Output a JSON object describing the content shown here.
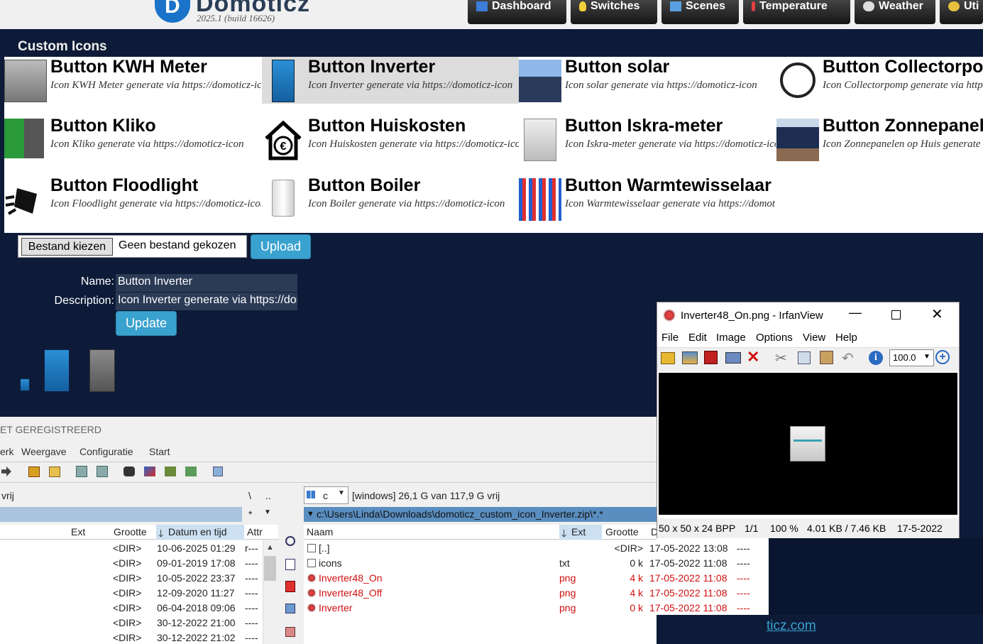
{
  "header": {
    "brand": "Domoticz",
    "version": "2025.1 (build 16626)",
    "nav": [
      {
        "label": "Dashboard",
        "icon": "dashboard-icon"
      },
      {
        "label": "Switches",
        "icon": "lightbulb-icon"
      },
      {
        "label": "Scenes",
        "icon": "scenes-icon"
      },
      {
        "label": "Temperature",
        "icon": "thermometer-icon"
      },
      {
        "label": "Weather",
        "icon": "cloud-icon"
      },
      {
        "label": "Uti",
        "icon": "utility-icon"
      }
    ]
  },
  "custom_icons": {
    "title": "Custom Icons",
    "items": [
      {
        "name": "Button KWH Meter",
        "desc": "Icon KWH Meter generate via https://domoticz-icon",
        "selected": false,
        "icon": "kwh-meter-icon"
      },
      {
        "name": "Button Inverter",
        "desc": "Icon Inverter generate via https://domoticz-icon",
        "selected": true,
        "icon": "inverter-icon"
      },
      {
        "name": "Button solar",
        "desc": "Icon solar generate via https://domoticz-icon",
        "selected": false,
        "icon": "solar-house-icon"
      },
      {
        "name": "Button Collectorpomp",
        "desc": "Icon Collectorpomp generate via https://domoticz-icon",
        "selected": false,
        "icon": "pump-icon"
      },
      {
        "name": "Button Kliko",
        "desc": "Icon Kliko generate via https://domoticz-icon",
        "selected": false,
        "icon": "bin-icon"
      },
      {
        "name": "Button Huiskosten",
        "desc": "Icon Huiskosten generate via https://domoticz-icon",
        "selected": false,
        "icon": "house-euro-icon"
      },
      {
        "name": "Button Iskra-meter",
        "desc": "Icon Iskra-meter generate via https://domoticz-icon",
        "selected": false,
        "icon": "meter-icon"
      },
      {
        "name": "Button Zonnepanelen",
        "desc": "Icon Zonnepanelen op Huis generate via https://domoticz-icon",
        "selected": false,
        "icon": "solar-panel-house-icon"
      },
      {
        "name": "Button Floodlight",
        "desc": "Icon Floodlight generate via https://domoticz-icon",
        "selected": false,
        "icon": "floodlight-icon"
      },
      {
        "name": "Button Boiler",
        "desc": "Icon Boiler generate via https://domoticz-icon",
        "selected": false,
        "icon": "boiler-icon"
      },
      {
        "name": "Button Warmtewisselaar",
        "desc": "Icon Warmtewisselaar generate via https://domoticz-icon",
        "selected": false,
        "icon": "heat-exchanger-icon"
      }
    ]
  },
  "upload": {
    "choose_label": "Bestand kiezen",
    "no_file": "Geen bestand gekozen",
    "upload_label": "Upload"
  },
  "form": {
    "name_label": "Name:",
    "name_value": "Button Inverter",
    "desc_label": "Description:",
    "desc_value": "Icon Inverter generate via https://domoticz-icon",
    "update_label": "Update"
  },
  "footer_link": "ticz.com",
  "explorer": {
    "unregistered": "ET GEREGISTREERD",
    "menu": [
      "erk",
      "Weergave",
      "Configuratie",
      "Start"
    ],
    "left_free": "vrij",
    "left_path_sep": "\\",
    "left_path_up": "..",
    "left_filter": "*",
    "left_cols": {
      "ext": "Ext",
      "size": "Grootte",
      "date": "Datum en tijd",
      "attr": "Attr"
    },
    "left_rows": [
      {
        "size": "<DIR>",
        "date": "10-06-2025 01:29",
        "attr": "r---"
      },
      {
        "size": "<DIR>",
        "date": "09-01-2019 17:08",
        "attr": "----"
      },
      {
        "size": "<DIR>",
        "date": "10-05-2022 23:37",
        "attr": "----"
      },
      {
        "size": "<DIR>",
        "date": "12-09-2020 11:27",
        "attr": "----"
      },
      {
        "size": "<DIR>",
        "date": "06-04-2018 09:06",
        "attr": "----"
      },
      {
        "size": "<DIR>",
        "date": "30-12-2022 21:00",
        "attr": "----"
      },
      {
        "size": "<DIR>",
        "date": "30-12-2022 21:02",
        "attr": "----"
      }
    ],
    "drive": "c",
    "drive_info": "[windows]  26,1 G van 117,9 G vrij",
    "right_path": "c:\\Users\\Linda\\Downloads\\domoticz_custom_icon_Inverter.zip\\*.*",
    "right_cols": {
      "name": "Naam",
      "ext": "Ext",
      "size": "Grootte",
      "date": "D"
    },
    "right_rows": [
      {
        "name": "[..]",
        "ext": "",
        "size": "<DIR>",
        "date": "17-05-2022 13:08",
        "attr": "----",
        "red": false
      },
      {
        "name": "icons",
        "ext": "txt",
        "size": "0 k",
        "date": "17-05-2022 11:08",
        "attr": "----",
        "red": false
      },
      {
        "name": "Inverter48_On",
        "ext": "png",
        "size": "4 k",
        "date": "17-05-2022 11:08",
        "attr": "----",
        "red": true
      },
      {
        "name": "Inverter48_Off",
        "ext": "png",
        "size": "4 k",
        "date": "17-05-2022 11:08",
        "attr": "----",
        "red": true
      },
      {
        "name": "Inverter",
        "ext": "png",
        "size": "0 k",
        "date": "17-05-2022 11:08",
        "attr": "----",
        "red": true
      }
    ]
  },
  "irfanview": {
    "title": "Inverter48_On.png - IrfanView",
    "menu": [
      "File",
      "Edit",
      "Image",
      "Options",
      "View",
      "Help"
    ],
    "zoom": "100.0",
    "status": [
      "50 x 50 x 24 BPP",
      "1/1",
      "100 %",
      "4.01 KB / 7.46 KB",
      "17-5-2022"
    ]
  },
  "colors": {
    "background": "#0d1b38",
    "accent": "#3aa2cf",
    "selected_tile": "#dcdcdc",
    "zip_file_red": "#d01010"
  }
}
